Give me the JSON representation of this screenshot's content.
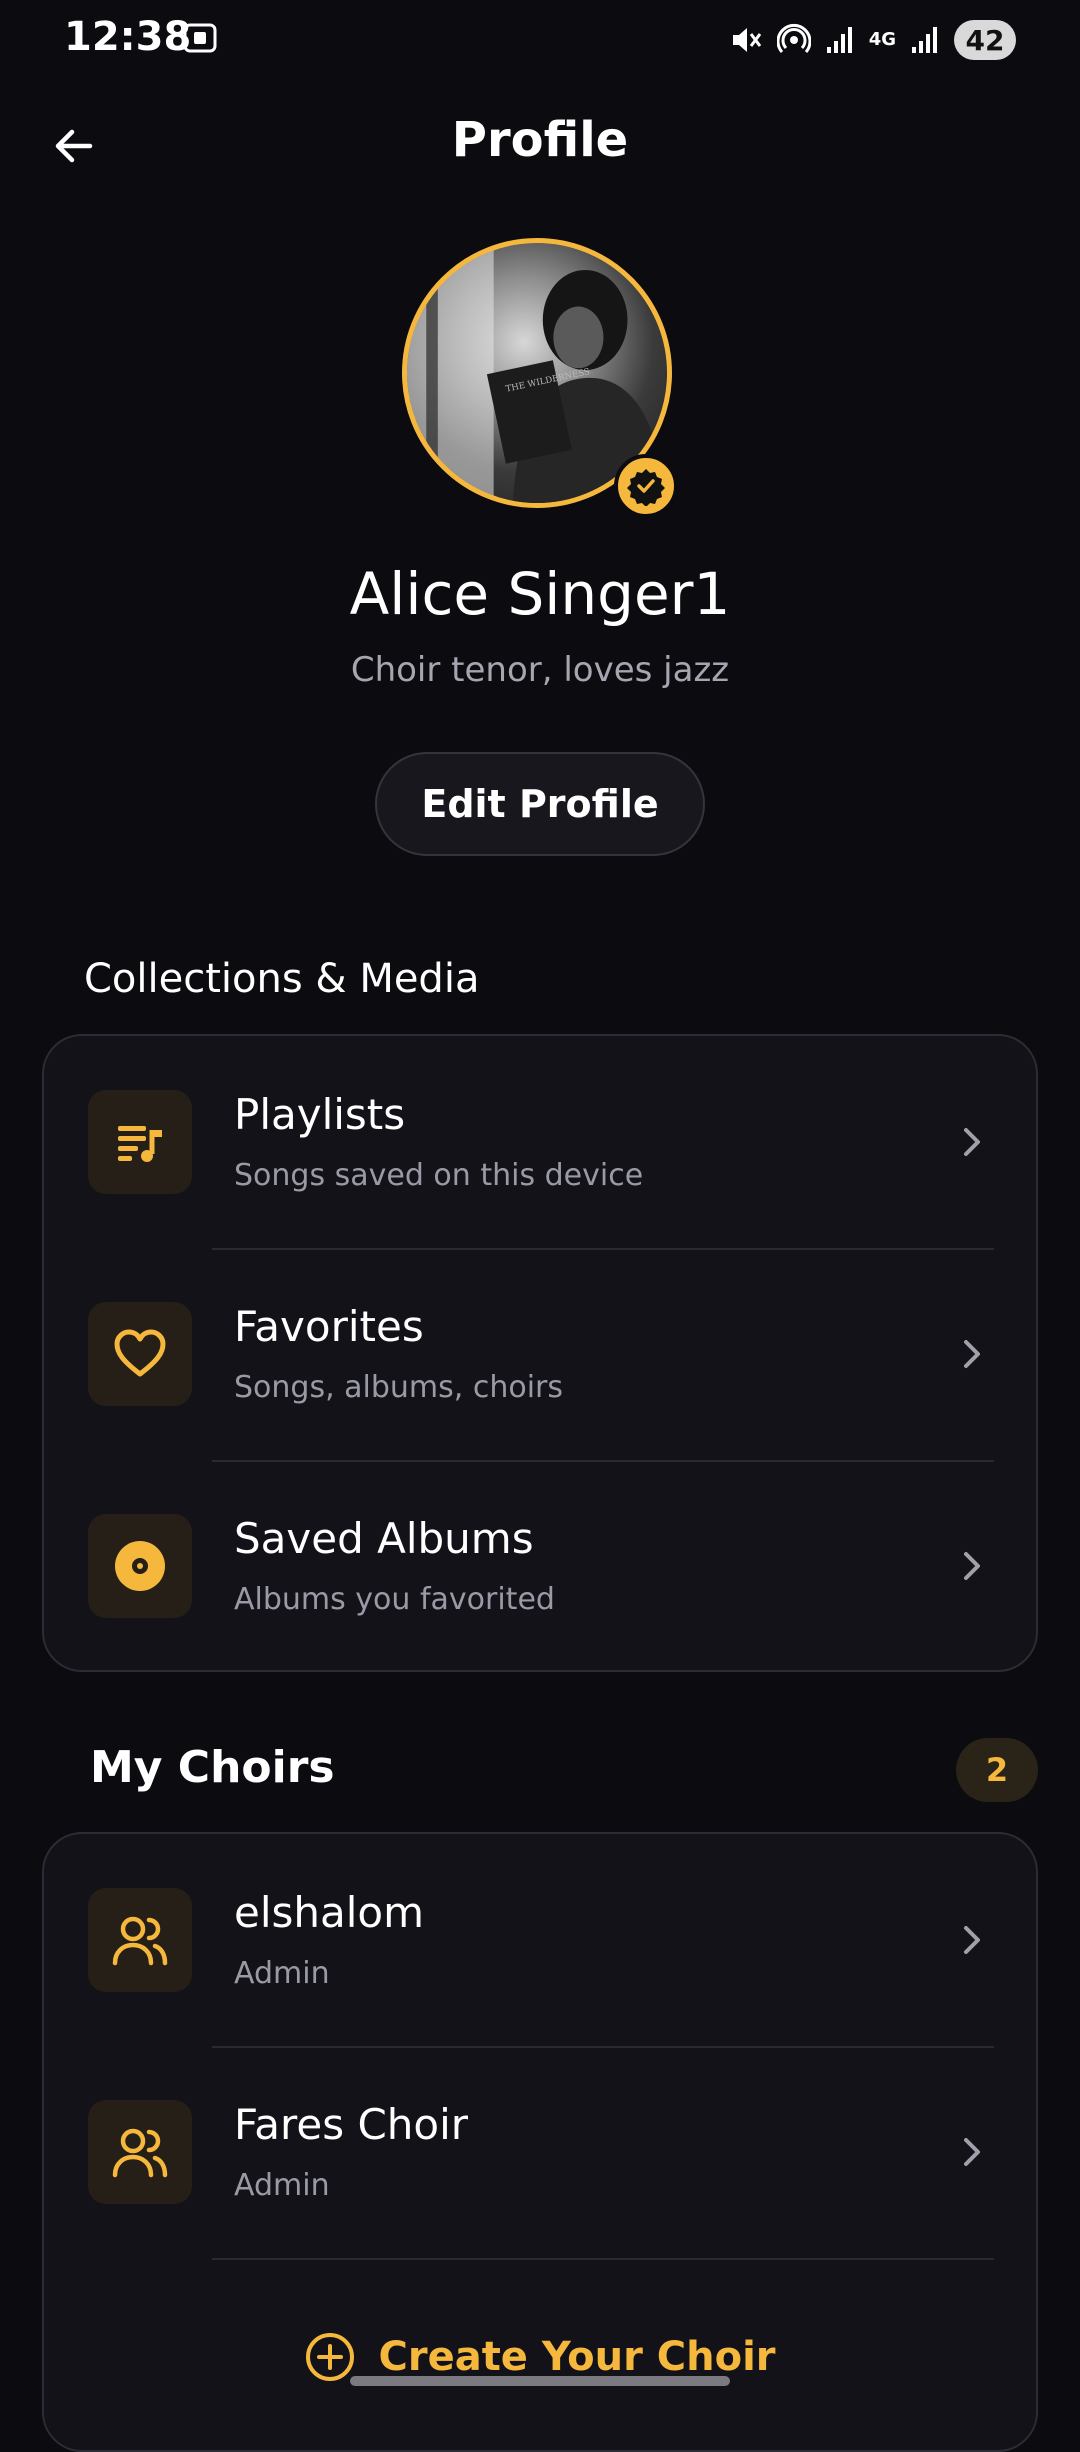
{
  "status_bar": {
    "time": "12:38",
    "network": "4G",
    "battery": "42"
  },
  "header": {
    "title": "Profile"
  },
  "profile": {
    "name": "Alice Singer1",
    "bio": "Choir tenor, loves jazz",
    "edit_label": "Edit Profile",
    "avatar_book_title": "THE WILDERNESS"
  },
  "collections": {
    "title": "Collections & Media",
    "items": [
      {
        "label": "Playlists",
        "sub": "Songs saved on this device",
        "icon": "playlist-icon"
      },
      {
        "label": "Favorites",
        "sub": "Songs, albums, choirs",
        "icon": "heart-icon"
      },
      {
        "label": "Saved Albums",
        "sub": "Albums you favorited",
        "icon": "album-icon"
      }
    ]
  },
  "choirs": {
    "title": "My Choirs",
    "count": "2",
    "items": [
      {
        "label": "elshalom",
        "sub": "Admin",
        "icon": "group-icon"
      },
      {
        "label": "Fares Choir",
        "sub": "Admin",
        "icon": "group-icon"
      }
    ],
    "create_label": "Create Your Choir"
  },
  "colors": {
    "accent": "#f5b83d",
    "background": "#0b0b10",
    "card": "#121218"
  }
}
